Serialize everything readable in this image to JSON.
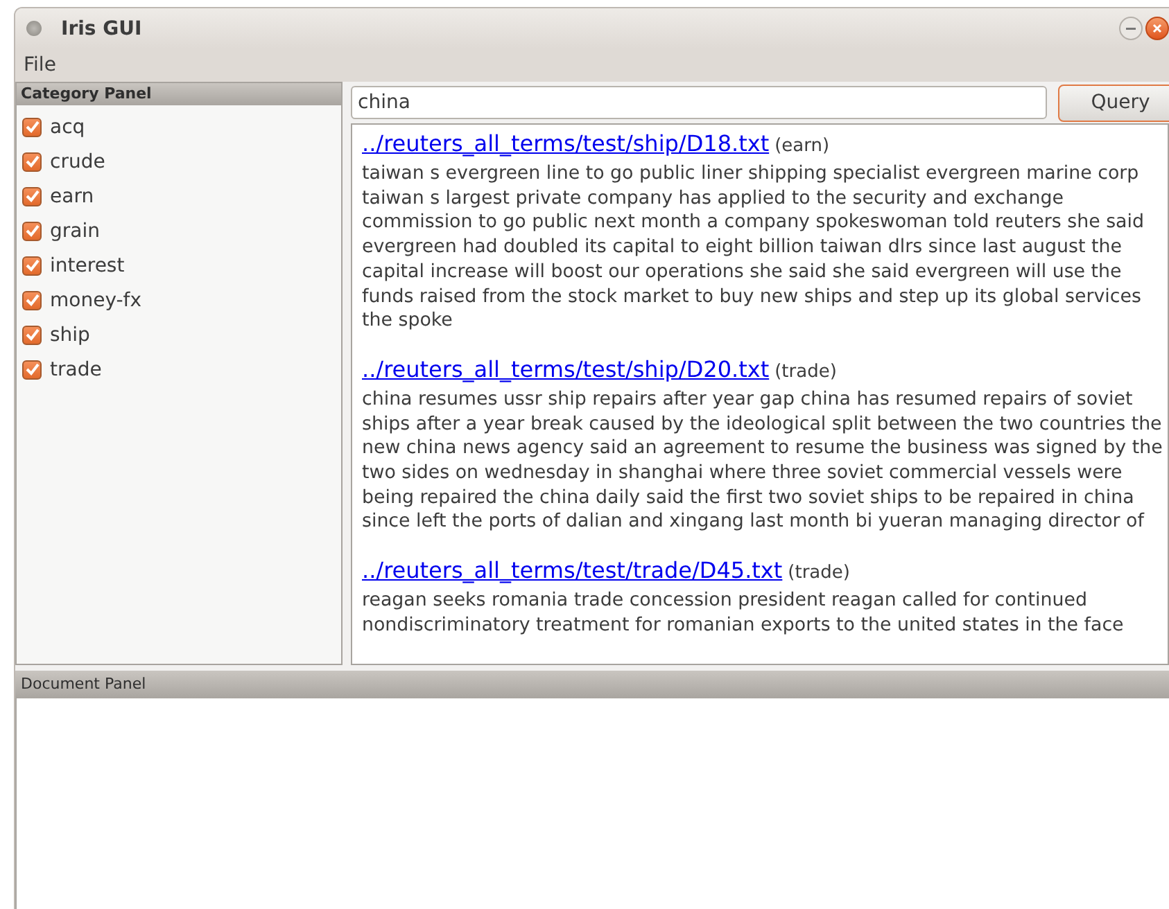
{
  "window": {
    "title": "Iris GUI"
  },
  "menu": [
    "File"
  ],
  "category_panel": {
    "title": "Category Panel",
    "items": [
      {
        "label": "acq",
        "checked": true
      },
      {
        "label": "crude",
        "checked": true
      },
      {
        "label": "earn",
        "checked": true
      },
      {
        "label": "grain",
        "checked": true
      },
      {
        "label": "interest",
        "checked": true
      },
      {
        "label": "money-fx",
        "checked": true
      },
      {
        "label": "ship",
        "checked": true
      },
      {
        "label": "trade",
        "checked": true
      }
    ]
  },
  "search": {
    "value": "china",
    "button": "Query"
  },
  "results": [
    {
      "path": "../reuters_all_terms/test/ship/D18.txt",
      "category": "(earn)",
      "text": "taiwan s evergreen line to go public liner shipping specialist evergreen marine corp taiwan s largest private company has applied to the security and exchange commission to go public next month a company spokeswoman told reuters she said evergreen had doubled its capital to eight billion taiwan dlrs since last august the capital increase will boost our operations she said she said evergreen will use the funds raised from the stock market to buy new ships and step up its global services the spoke"
    },
    {
      "path": "../reuters_all_terms/test/ship/D20.txt",
      "category": "(trade)",
      "text": "china resumes ussr ship repairs after year gap china has resumed repairs of soviet ships after a year break caused by the ideological split between the two countries the new china news agency said an agreement to resume the business was signed by the two sides on wednesday in shanghai where three soviet commercial vessels were being repaired the china daily said the first two soviet ships to be repaired in china since left the ports of dalian and xingang last month bi yueran managing director of"
    },
    {
      "path": "../reuters_all_terms/test/trade/D45.txt",
      "category": "(trade)",
      "text": "reagan seeks romania trade concession president reagan called for continued nondiscriminatory treatment for romanian exports to the united states in the face"
    }
  ],
  "document_panel": {
    "title": "Document Panel"
  }
}
